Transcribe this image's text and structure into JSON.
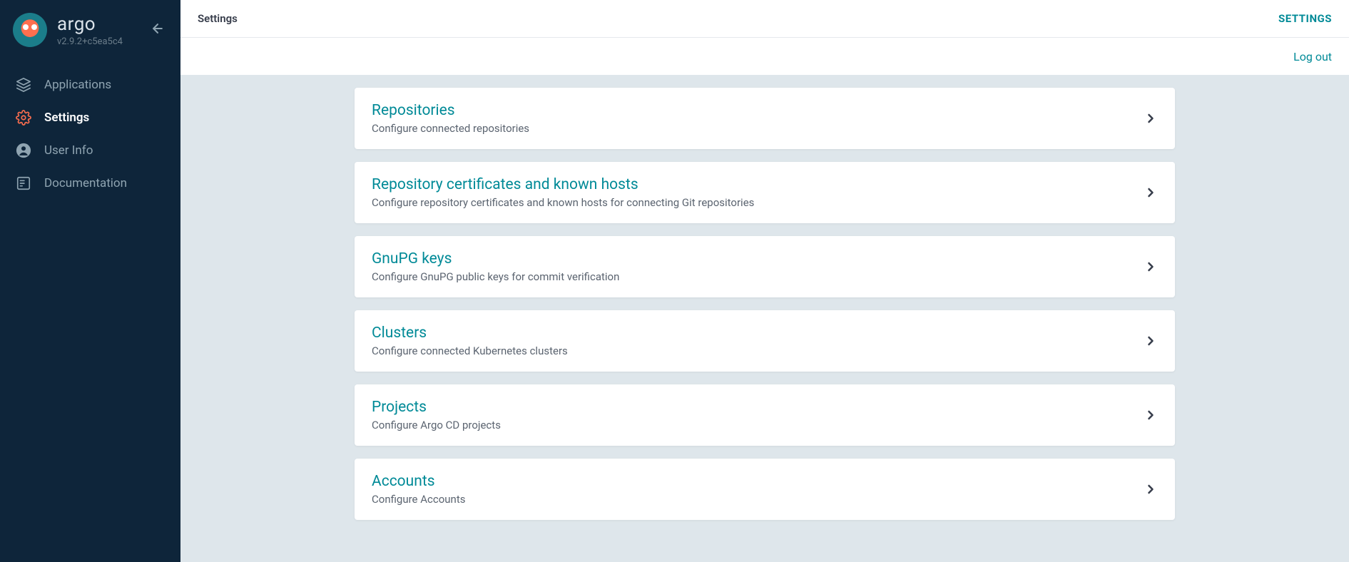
{
  "brand": {
    "name": "argo",
    "version": "v2.9.2+c5ea5c4"
  },
  "sidebar": {
    "items": [
      {
        "label": "Applications",
        "icon": "layers",
        "active": false
      },
      {
        "label": "Settings",
        "icon": "gear",
        "active": true
      },
      {
        "label": "User Info",
        "icon": "user",
        "active": false
      },
      {
        "label": "Documentation",
        "icon": "book",
        "active": false
      }
    ]
  },
  "header": {
    "breadcrumb": "Settings",
    "right_label": "SETTINGS",
    "logout": "Log out"
  },
  "settings_cards": [
    {
      "title": "Repositories",
      "description": "Configure connected repositories"
    },
    {
      "title": "Repository certificates and known hosts",
      "description": "Configure repository certificates and known hosts for connecting Git repositories"
    },
    {
      "title": "GnuPG keys",
      "description": "Configure GnuPG public keys for commit verification"
    },
    {
      "title": "Clusters",
      "description": "Configure connected Kubernetes clusters"
    },
    {
      "title": "Projects",
      "description": "Configure Argo CD projects"
    },
    {
      "title": "Accounts",
      "description": "Configure Accounts"
    }
  ]
}
